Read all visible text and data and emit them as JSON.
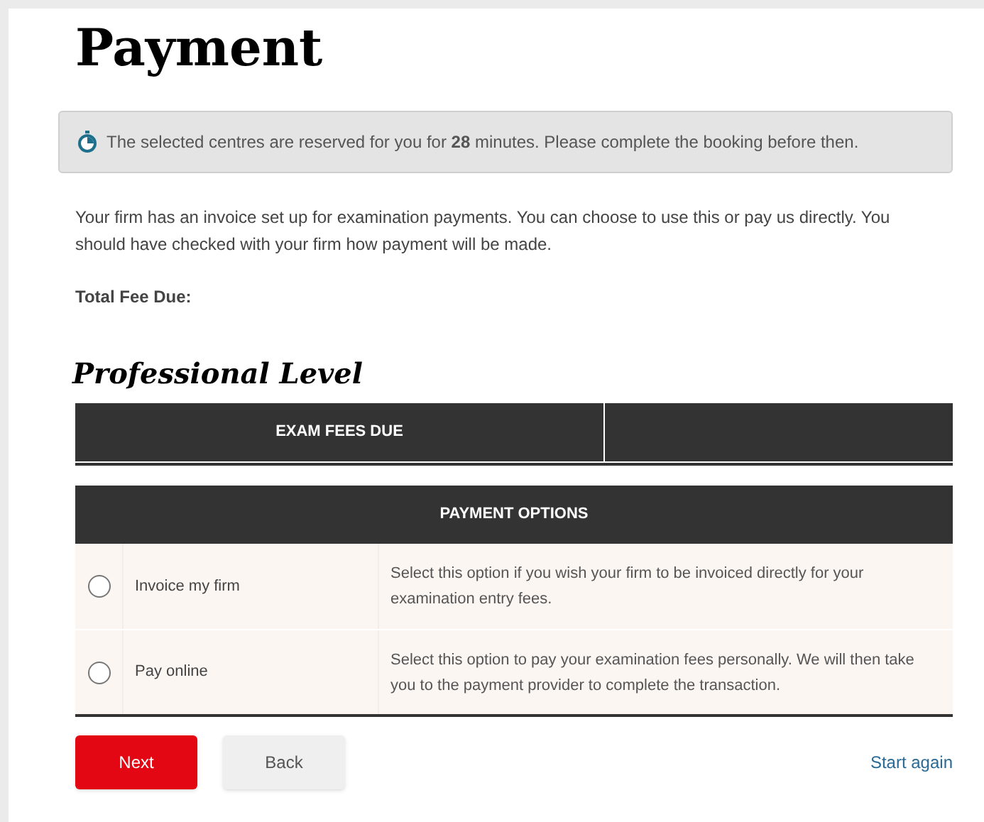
{
  "title": "Payment",
  "notice": {
    "text": "The selected centres are reserved for you for **28** minutes. Please complete the booking before then."
  },
  "intro": "Your firm has an invoice set up for examination payments. You can choose to use this or pay us directly. You should have checked with your firm how payment will be made.",
  "total_fee_label": "Total Fee Due:",
  "section_title": "Professional Level",
  "fees_table": {
    "columns": [
      "EXAM FEES DUE"
    ]
  },
  "payment_options": {
    "heading": "PAYMENT OPTIONS",
    "options": [
      {
        "label": "Invoice my firm",
        "description": "Select this option if you wish your firm to be invoiced directly for your examination entry fees.",
        "selected": false
      },
      {
        "label": "Pay online",
        "description": "Select this option to pay your examination fees personally. We will then take you to the payment provider to complete the transaction.",
        "selected": false
      }
    ]
  },
  "buttons": [
    "Next",
    "Back"
  ],
  "start_again": "Start again"
}
